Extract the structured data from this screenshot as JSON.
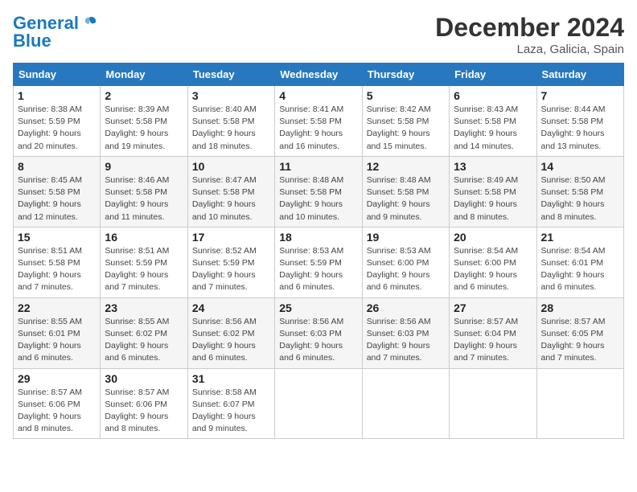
{
  "logo": {
    "line1": "General",
    "line2": "Blue"
  },
  "title": "December 2024",
  "location": "Laza, Galicia, Spain",
  "days_header": [
    "Sunday",
    "Monday",
    "Tuesday",
    "Wednesday",
    "Thursday",
    "Friday",
    "Saturday"
  ],
  "weeks": [
    [
      {
        "day": "1",
        "sunrise": "8:38 AM",
        "sunset": "5:59 PM",
        "daylight": "9 hours and 20 minutes."
      },
      {
        "day": "2",
        "sunrise": "8:39 AM",
        "sunset": "5:58 PM",
        "daylight": "9 hours and 19 minutes."
      },
      {
        "day": "3",
        "sunrise": "8:40 AM",
        "sunset": "5:58 PM",
        "daylight": "9 hours and 18 minutes."
      },
      {
        "day": "4",
        "sunrise": "8:41 AM",
        "sunset": "5:58 PM",
        "daylight": "9 hours and 16 minutes."
      },
      {
        "day": "5",
        "sunrise": "8:42 AM",
        "sunset": "5:58 PM",
        "daylight": "9 hours and 15 minutes."
      },
      {
        "day": "6",
        "sunrise": "8:43 AM",
        "sunset": "5:58 PM",
        "daylight": "9 hours and 14 minutes."
      },
      {
        "day": "7",
        "sunrise": "8:44 AM",
        "sunset": "5:58 PM",
        "daylight": "9 hours and 13 minutes."
      }
    ],
    [
      {
        "day": "8",
        "sunrise": "8:45 AM",
        "sunset": "5:58 PM",
        "daylight": "9 hours and 12 minutes."
      },
      {
        "day": "9",
        "sunrise": "8:46 AM",
        "sunset": "5:58 PM",
        "daylight": "9 hours and 11 minutes."
      },
      {
        "day": "10",
        "sunrise": "8:47 AM",
        "sunset": "5:58 PM",
        "daylight": "9 hours and 10 minutes."
      },
      {
        "day": "11",
        "sunrise": "8:48 AM",
        "sunset": "5:58 PM",
        "daylight": "9 hours and 10 minutes."
      },
      {
        "day": "12",
        "sunrise": "8:48 AM",
        "sunset": "5:58 PM",
        "daylight": "9 hours and 9 minutes."
      },
      {
        "day": "13",
        "sunrise": "8:49 AM",
        "sunset": "5:58 PM",
        "daylight": "9 hours and 8 minutes."
      },
      {
        "day": "14",
        "sunrise": "8:50 AM",
        "sunset": "5:58 PM",
        "daylight": "9 hours and 8 minutes."
      }
    ],
    [
      {
        "day": "15",
        "sunrise": "8:51 AM",
        "sunset": "5:58 PM",
        "daylight": "9 hours and 7 minutes."
      },
      {
        "day": "16",
        "sunrise": "8:51 AM",
        "sunset": "5:59 PM",
        "daylight": "9 hours and 7 minutes."
      },
      {
        "day": "17",
        "sunrise": "8:52 AM",
        "sunset": "5:59 PM",
        "daylight": "9 hours and 7 minutes."
      },
      {
        "day": "18",
        "sunrise": "8:53 AM",
        "sunset": "5:59 PM",
        "daylight": "9 hours and 6 minutes."
      },
      {
        "day": "19",
        "sunrise": "8:53 AM",
        "sunset": "6:00 PM",
        "daylight": "9 hours and 6 minutes."
      },
      {
        "day": "20",
        "sunrise": "8:54 AM",
        "sunset": "6:00 PM",
        "daylight": "9 hours and 6 minutes."
      },
      {
        "day": "21",
        "sunrise": "8:54 AM",
        "sunset": "6:01 PM",
        "daylight": "9 hours and 6 minutes."
      }
    ],
    [
      {
        "day": "22",
        "sunrise": "8:55 AM",
        "sunset": "6:01 PM",
        "daylight": "9 hours and 6 minutes."
      },
      {
        "day": "23",
        "sunrise": "8:55 AM",
        "sunset": "6:02 PM",
        "daylight": "9 hours and 6 minutes."
      },
      {
        "day": "24",
        "sunrise": "8:56 AM",
        "sunset": "6:02 PM",
        "daylight": "9 hours and 6 minutes."
      },
      {
        "day": "25",
        "sunrise": "8:56 AM",
        "sunset": "6:03 PM",
        "daylight": "9 hours and 6 minutes."
      },
      {
        "day": "26",
        "sunrise": "8:56 AM",
        "sunset": "6:03 PM",
        "daylight": "9 hours and 7 minutes."
      },
      {
        "day": "27",
        "sunrise": "8:57 AM",
        "sunset": "6:04 PM",
        "daylight": "9 hours and 7 minutes."
      },
      {
        "day": "28",
        "sunrise": "8:57 AM",
        "sunset": "6:05 PM",
        "daylight": "9 hours and 7 minutes."
      }
    ],
    [
      {
        "day": "29",
        "sunrise": "8:57 AM",
        "sunset": "6:06 PM",
        "daylight": "9 hours and 8 minutes."
      },
      {
        "day": "30",
        "sunrise": "8:57 AM",
        "sunset": "6:06 PM",
        "daylight": "9 hours and 8 minutes."
      },
      {
        "day": "31",
        "sunrise": "8:58 AM",
        "sunset": "6:07 PM",
        "daylight": "9 hours and 9 minutes."
      },
      null,
      null,
      null,
      null
    ]
  ]
}
